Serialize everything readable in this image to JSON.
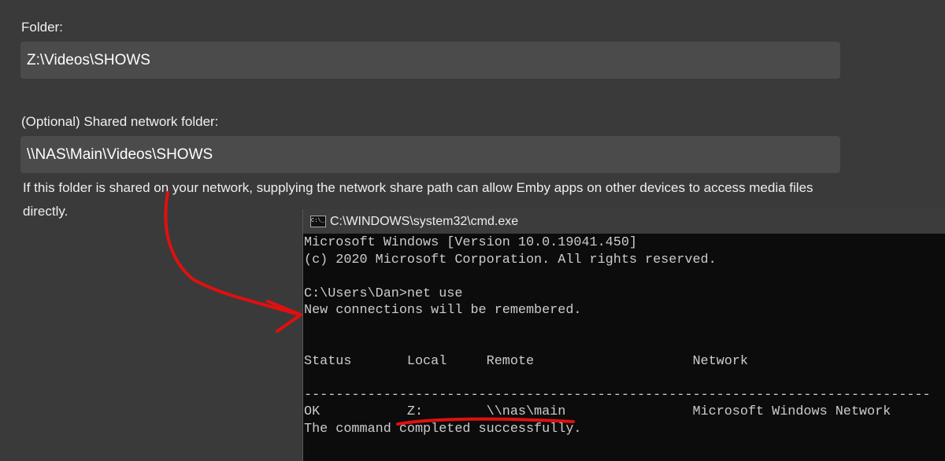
{
  "form": {
    "folder_label": "Folder:",
    "folder_value": "Z:\\Videos\\SHOWS",
    "shared_label": "(Optional) Shared network folder:",
    "shared_value": "\\\\NAS\\Main\\Videos\\SHOWS",
    "help_text": "If this folder is shared on your network, supplying the network share path can allow Emby apps on other devices to access media files directly."
  },
  "terminal": {
    "title": "C:\\WINDOWS\\system32\\cmd.exe",
    "icon": "cmd-icon",
    "lines": [
      "Microsoft Windows [Version 10.0.19041.450]",
      "(c) 2020 Microsoft Corporation. All rights reserved.",
      "",
      "C:\\Users\\Dan>net use",
      "New connections will be remembered.",
      "",
      "",
      "Status       Local     Remote                    Network",
      "",
      "-------------------------------------------------------------------------------",
      "OK           Z:        \\\\nas\\main                Microsoft Windows Network",
      "The command completed successfully."
    ]
  },
  "annotation_color": "#e01010"
}
